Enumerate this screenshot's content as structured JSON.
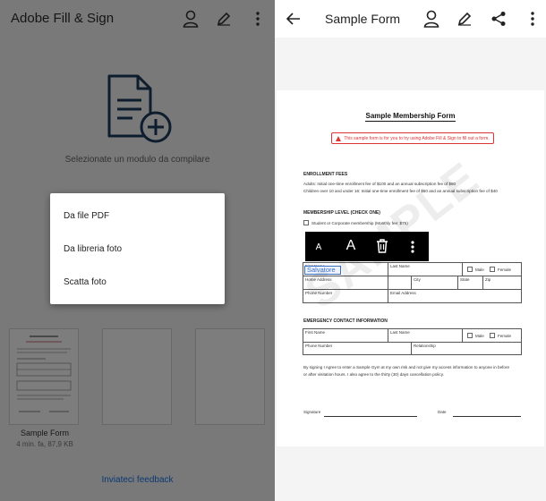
{
  "left": {
    "app_title": "Adobe Fill & Sign",
    "icons": [
      "account-icon",
      "pen-icon",
      "more-vert-icon"
    ],
    "caption": "Selezionate un modulo da compilare",
    "recent": {
      "name": "Sample Form",
      "meta": "4 min. fa, 87,9 KB"
    },
    "feedback": "Inviateci feedback",
    "menu": [
      "Da file PDF",
      "Da libreria foto",
      "Scatta foto"
    ]
  },
  "right": {
    "title": "Sample Form",
    "icons": [
      "back-arrow-icon",
      "account-icon",
      "pen-icon",
      "share-icon",
      "more-vert-icon"
    ],
    "toolbar": {
      "small_a": "A",
      "large_a": "A",
      "trash": "trash-icon",
      "more": "more-vert-icon"
    },
    "doc": {
      "title": "Sample Membership Form",
      "notice": "This sample form is for you to try using Adobe Fill & Sign to fill out a form.",
      "enroll_header": "ENROLLMENT FEES",
      "enroll_line1": "Adults: Initial one-time enrollment fee of $100 and an annual subscription fee of $80",
      "enroll_line2": "Children over 10 and under 16: Initial one-time enrollment fee of $50 and an annual subscription fee of $40",
      "membership_header": "MEMBERSHIP LEVEL (CHECK ONE)",
      "membership_option": "Student or Corporate membership (Monthly fee: $75)",
      "first_name": "First Name",
      "last_name": "Last Name",
      "male": "Male",
      "female": "Female",
      "home_address": "Home Address",
      "city": "City",
      "state": "State",
      "zip": "Zip",
      "phone": "Phone Number",
      "email": "Email Address",
      "emergency_header": "EMERGENCY CONTACT INFORMATION",
      "relationship": "Relationship",
      "agree1": "By signing I Agree to enter a Sample Gym at my own risk and not give my access information to anyone in before",
      "agree2": "or after visitation hours. I also agree to the thirty (30) days cancellation policy.",
      "signature": "Signature",
      "date": "Date",
      "watermark": "SAMPLE",
      "field_value": "Salvatore"
    }
  }
}
